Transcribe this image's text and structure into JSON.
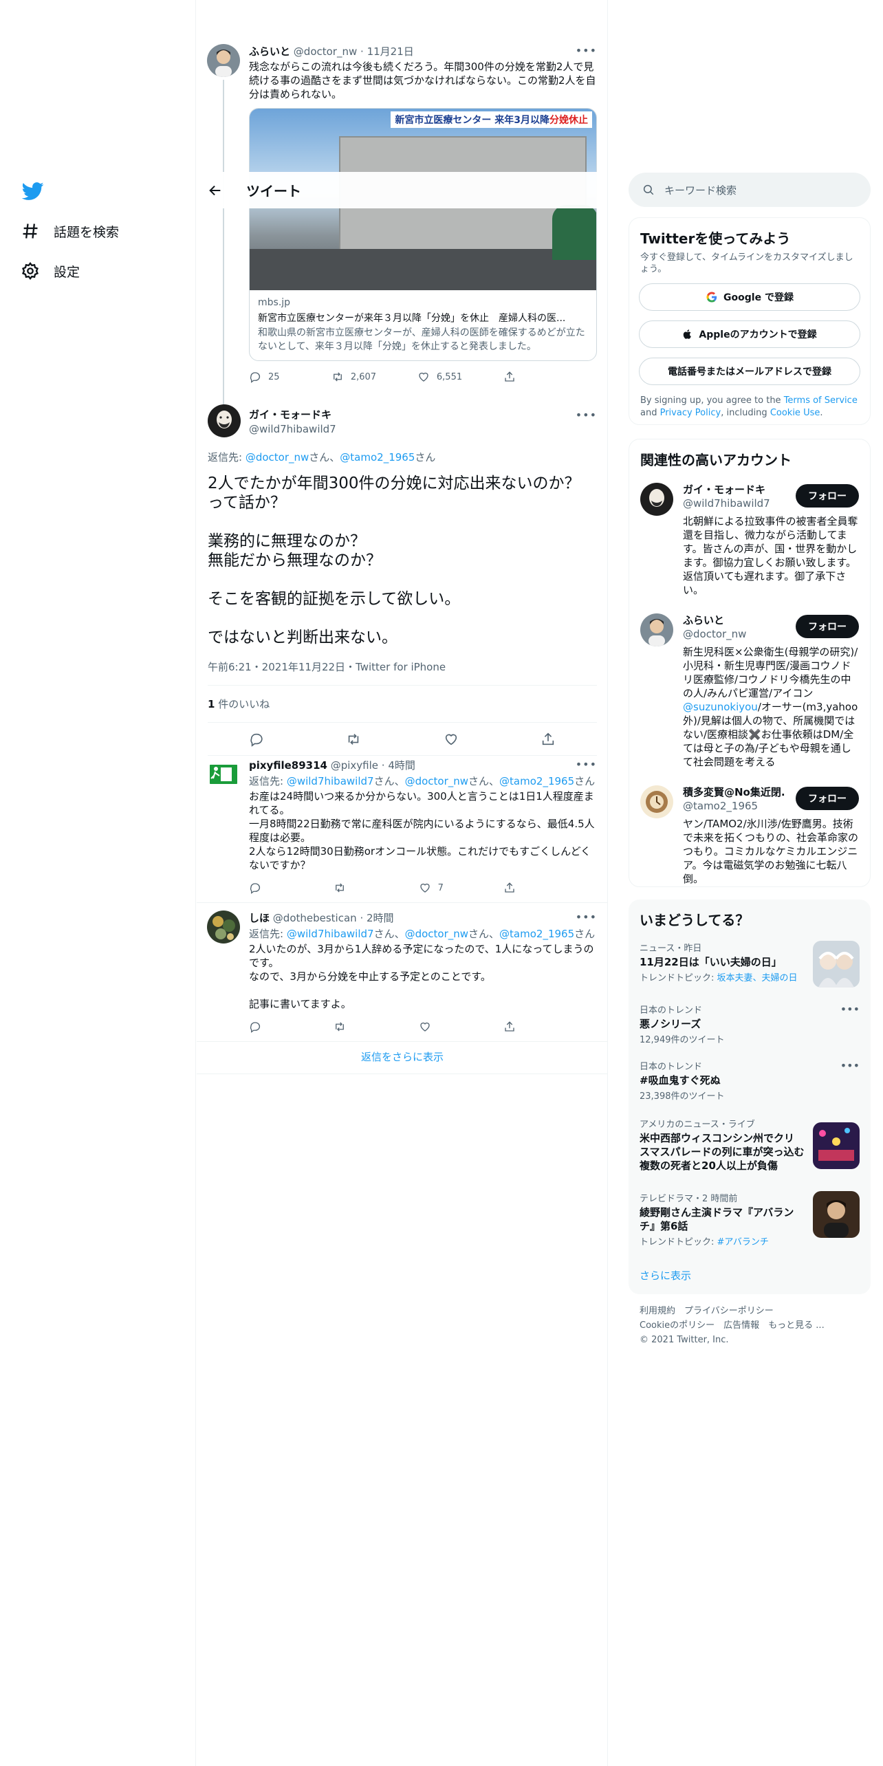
{
  "nav": {
    "explore_label": "話題を検索",
    "settings_label": "設定"
  },
  "header": {
    "title": "ツイート"
  },
  "parent_tweet": {
    "name": "ふらいと",
    "handle": "@doctor_nw",
    "date": "11月21日",
    "text": "残念ながらこの流れは今後も続くだろう。年間300件の分娩を常勤2人で見続ける事の過酷さをまず世間は気づかなければならない。この常勤2人を自分は責められない。",
    "card": {
      "overlay_title_a": "新宮市立医療センター",
      "overlay_title_b": "来年3月以降",
      "overlay_title_c": "分娩休止",
      "domain": "mbs.jp",
      "title": "新宮市立医療センターが来年３月以降「分娩」を休止　産婦人科の医...",
      "description": "和歌山県の新宮市立医療センターが、産婦人科の医師を確保するめどが立たないとして、来年３月以降「分娩」を休止すると発表しました。"
    },
    "replies": "25",
    "retweets": "2,607",
    "likes": "6,551"
  },
  "main_tweet": {
    "name": "ガイ・モォードキ",
    "handle": "@wild7hibawild7",
    "reply_prefix": "返信先: ",
    "reply_to_1": "@doctor_nw",
    "reply_mid": "さん、",
    "reply_to_2": "@tamo2_1965",
    "reply_suffix": "さん",
    "line1": "2人でたかが年間300件の分娩に対応出来ないのか？って話か？",
    "line2": "業務的に無理なのか？",
    "line3": "無能だから無理なのか？",
    "line4": "そこを客観的証拠を示して欲しい。",
    "line5": "ではないと判断出来ない。",
    "timestamp": "午前6:21・2021年11月22日・Twitter for iPhone",
    "like_count": "1",
    "like_label": " 件のいいね"
  },
  "replies": [
    {
      "name": "pixyfile89314",
      "handle": "@pixyfile",
      "time": "4時間",
      "reply_prefix": "返信先: ",
      "to1": "@wild7hibawild7",
      "to2": "@doctor_nw",
      "to3": "@tamo2_1965",
      "san": "さん",
      "sep": "さん、",
      "text": "お産は24時間いつ来るか分からない。300人と言うことは1日1人程度産まれてる。\n一月8時間22日勤務で常に産科医が院内にいるようにするなら、最低4.5人程度は必要。\n2人なら12時間30日勤務orオンコール状態。これだけでもすごくしんどくないですか？",
      "likes": "7"
    },
    {
      "name": "しほ",
      "handle": "@dothebestican",
      "time": "2時間",
      "reply_prefix": "返信先: ",
      "to1": "@wild7hibawild7",
      "to2": "@doctor_nw",
      "to3": "@tamo2_1965",
      "san": "さん",
      "sep": "さん、",
      "text": "2人いたのが、3月から1人辞める予定になったので、1人になってしまうのです。\nなので、3月から分娩を中止する予定とのことです。\n\n記事に書いてますよ。",
      "likes": ""
    }
  ],
  "show_more": "返信をさらに表示",
  "search": {
    "placeholder": "キーワード検索"
  },
  "signup": {
    "title": "Twitterを使ってみよう",
    "subtitle": "今すぐ登録して、タイムラインをカスタマイズしましょう。",
    "google": "Google で登録",
    "apple": "Appleのアカウントで登録",
    "phone": "電話番号またはメールアドレスで登録",
    "terms_a": "By signing up, you agree to the ",
    "terms_link1": "Terms of Service",
    "terms_b": " and ",
    "terms_link2": "Privacy Policy",
    "terms_c": ", including ",
    "terms_link3": "Cookie Use",
    "terms_d": "."
  },
  "related": {
    "title": "関連性の高いアカウント",
    "follow_label": "フォロー",
    "accounts": [
      {
        "name": "ガイ・モォードキ",
        "handle": "@wild7hibawild7",
        "bio": "北朝鮮による拉致事件の被害者全員奪還を目指し、微力ながら活動してます。皆さんの声が、国・世界を動かします。御協力宜しくお願い致します。返信頂いても遅れます。御了承下さい。"
      },
      {
        "name": "ふらいと",
        "handle": "@doctor_nw",
        "bio_a": "新生児科医×公衆衛生(母親学の研究)/小児科・新生児専門医/漫画コウノドリ医療監修/コウノドリ今橋先生の中の人/みんパピ運営/アイコン",
        "bio_link": "@suzunokiyou",
        "bio_b": "/オーサー(m3,yahoo外)/見解は個人の物で、所属機関ではない/医療相談✖️お仕事依頼はDM/全ては母と子の為/子どもや母親を通して社会問題を考える"
      },
      {
        "name": "積多変賢@No集近閉...",
        "handle": "@tamo2_1965",
        "bio": "ヤン/TAMO2/氷川渉/佐野鷹男。技術で未来を拓くつもりの、社会革命家のつもり。コミカルなケミカルエンジニア。今は電磁気学のお勉強に七転八倒。"
      }
    ]
  },
  "trends": {
    "title": "いまどうしてる？",
    "items": [
      {
        "context": "ニュース・昨日",
        "title": "11月22日は「いい夫婦の日」",
        "sub_prefix": "トレンドトピック: ",
        "sub_link": "坂本夫妻、夫婦の日"
      },
      {
        "context": "日本のトレンド",
        "title": "悪ノシリーズ",
        "sub": "12,949件のツイート"
      },
      {
        "context": "日本のトレンド",
        "title": "#吸血鬼すぐ死ぬ",
        "sub": "23,398件のツイート"
      },
      {
        "context": "アメリカのニュース・ライブ",
        "title": "米中西部ウィスコンシン州でクリスマスパレードの列に車が突っ込む 複数の死者と20人以上が負傷"
      },
      {
        "context": "テレビドラマ・2 時間前",
        "title": "綾野剛さん主演ドラマ『アバランチ』第6話",
        "sub_prefix": "トレンドトピック: ",
        "sub_link": "#アバランチ"
      }
    ],
    "show_more": "さらに表示"
  },
  "footer": {
    "terms": "利用規約",
    "privacy": "プライバシーポリシー",
    "cookie": "Cookieのポリシー",
    "ads": "広告情報",
    "more": "もっと見る ...",
    "copyright": "© 2021 Twitter, Inc."
  },
  "colors": {
    "accent": "#1d9bf0",
    "text": "#0f1419",
    "secondary": "#536471"
  }
}
